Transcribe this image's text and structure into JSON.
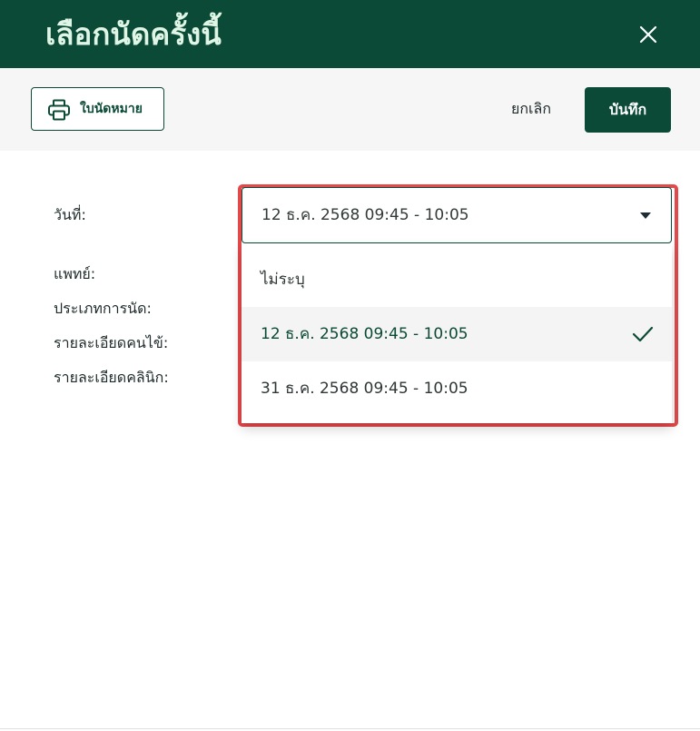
{
  "dialog": {
    "title": "เลือกนัดครั้งนี้"
  },
  "toolbar": {
    "print_label": "ใบนัดหมาย",
    "cancel_label": "ยกเลิก",
    "save_label": "บันทึก"
  },
  "form": {
    "date_label": "วันที่:",
    "doctor_label": "แพทย์:",
    "appointment_type_label": "ประเภทการนัด:",
    "patient_details_label": "รายละเอียดคนไข้:",
    "clinic_details_label": "รายละเอียดคลินิก:",
    "date_selected": "12 ธ.ค. 2568 09:45 - 10:05"
  },
  "date_options": [
    {
      "label": "ไม่ระบุ",
      "selected": false
    },
    {
      "label": "12 ธ.ค. 2568 09:45 - 10:05",
      "selected": true
    },
    {
      "label": "31 ธ.ค. 2568 09:45 - 10:05",
      "selected": false
    }
  ],
  "icons": {
    "close": "close-icon",
    "print": "printer-icon",
    "dropdown": "chevron-down-icon",
    "selected": "check-icon"
  },
  "colors": {
    "brand": "#0b4a37",
    "title_text": "#dff5e6",
    "highlight": "#e3484a"
  }
}
